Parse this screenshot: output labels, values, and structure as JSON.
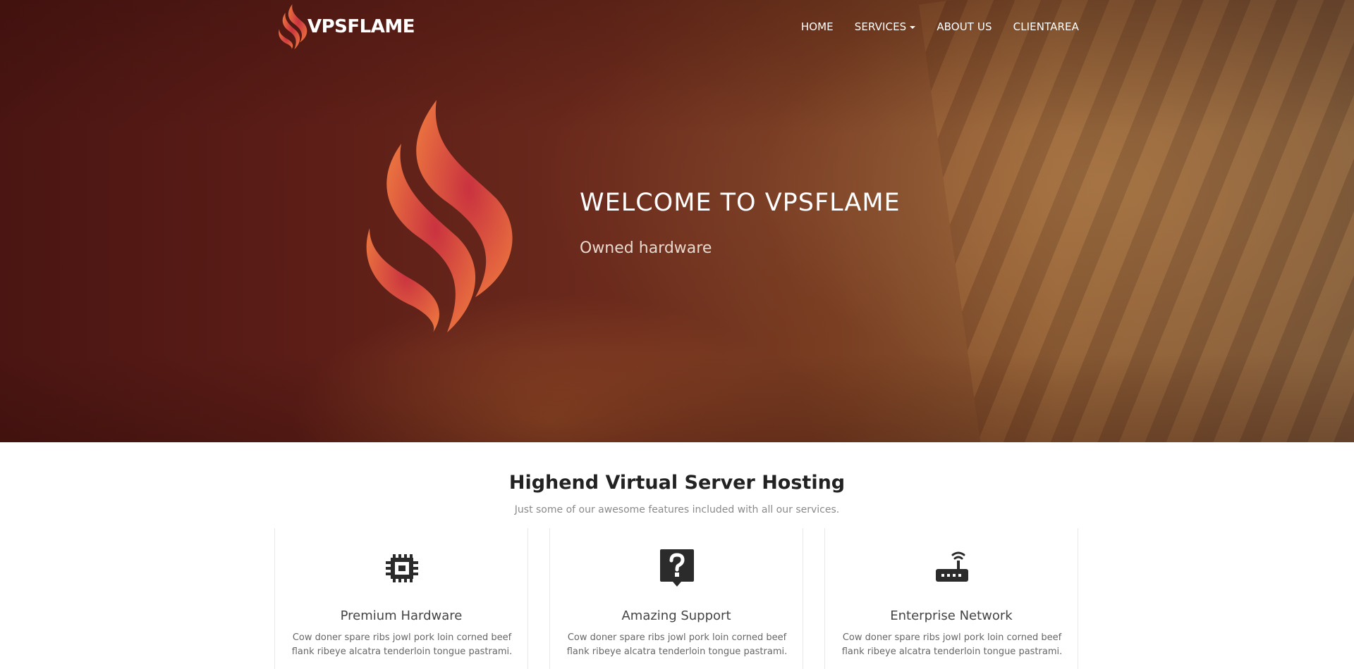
{
  "brand": {
    "name": "VPSFLAME",
    "logo_icon": "flame-icon"
  },
  "nav": {
    "items": [
      {
        "label": "HOME"
      },
      {
        "label": "SERVICES",
        "has_dropdown": true
      },
      {
        "label": "ABOUT US"
      },
      {
        "label": "CLIENTAREA"
      }
    ]
  },
  "hero": {
    "title": "WELCOME TO VPSFLAME",
    "subtitle": "Owned hardware",
    "icon": "flame-icon"
  },
  "features": {
    "title": "Highend Virtual Server Hosting",
    "subtitle": "Just some of our awesome features included with all our services.",
    "cards": [
      {
        "icon": "cpu-chip-icon",
        "title": "Premium Hardware",
        "text": "Cow doner spare ribs jowl pork loin corned beef flank ribeye alcatra tenderloin tongue pastrami."
      },
      {
        "icon": "question-bubble-icon",
        "title": "Amazing Support",
        "text": "Cow doner spare ribs jowl pork loin corned beef flank ribeye alcatra tenderloin tongue pastrami."
      },
      {
        "icon": "router-icon",
        "title": "Enterprise Network",
        "text": "Cow doner spare ribs jowl pork loin corned beef flank ribeye alcatra tenderloin tongue pastrami."
      }
    ]
  },
  "colors": {
    "hero_dark": "#4a1512",
    "flame_orange": "#e9703f",
    "flame_red": "#c9323f",
    "heading": "#222222",
    "muted": "#8a8a8a"
  }
}
